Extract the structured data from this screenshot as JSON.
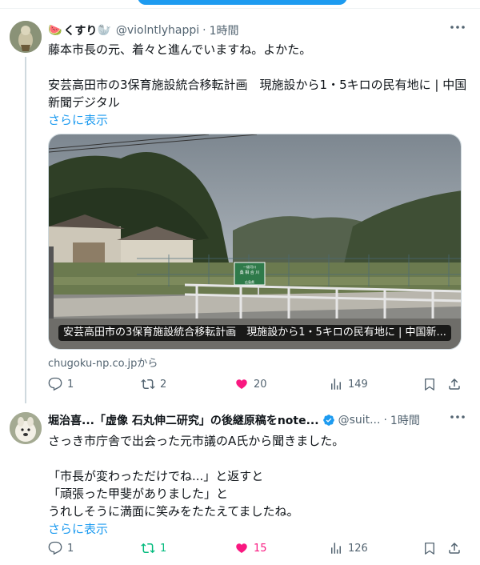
{
  "colors": {
    "accent": "#1d9bf0",
    "like": "#f91880",
    "repost": "#00ba7c",
    "muted": "#536471"
  },
  "tweets": [
    {
      "name": "くすり",
      "name_emoji_left": "🍉",
      "name_emoji_right": "🦭",
      "handle": "@violntlyhappi",
      "sep": "·",
      "time": "1時間",
      "body": [
        "藤本市長の元、着々と進んでいますね。よかた。",
        "",
        "安芸高田市の3保育施設統合移転計画　現施設から1・5キロの民有地に | 中国",
        "新聞デジタル"
      ],
      "show_more": "さらに表示",
      "card": {
        "title": "安芸高田市の3保育施設統合移転計画　現施設から1・5キロの民有地に | 中国新...",
        "source": "chugoku-np.co.jpから",
        "sign_lines": [
          "一級河川",
          "桑 相 合 川",
          "",
          "広島県"
        ]
      },
      "actions": {
        "replies": "1",
        "reposts": "2",
        "likes": "20",
        "views": "149"
      }
    },
    {
      "name": "堀治喜...「虚像 石丸伸二研究」の後継原稿をnote...",
      "handle": "@suit...",
      "sep": "·",
      "time": "1時間",
      "body": [
        "さっき市庁舎で出会った元市議のA氏から聞きました。",
        "",
        "「市長が変わっただけでね...」と返すと",
        "「頑張った甲斐がありました」と",
        "うれしそうに満面に笑みをたたえてましたね。"
      ],
      "show_more": "さらに表示",
      "actions": {
        "replies": "1",
        "reposts": "1",
        "likes": "15",
        "views": "126"
      }
    }
  ]
}
